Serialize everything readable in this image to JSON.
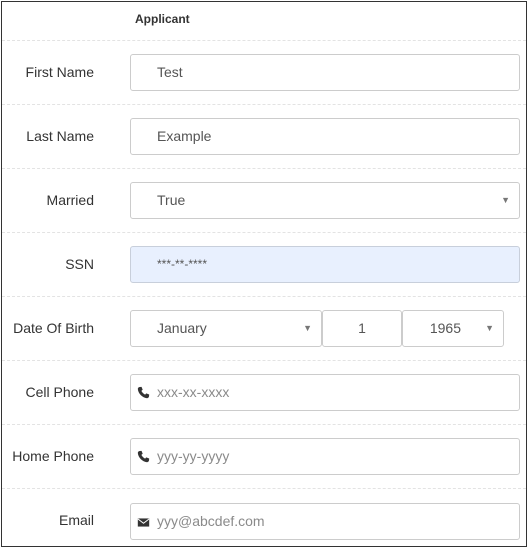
{
  "form": {
    "header": "Applicant",
    "first_name": {
      "label": "First Name",
      "value": "Test"
    },
    "last_name": {
      "label": "Last Name",
      "value": "Example"
    },
    "married": {
      "label": "Married",
      "value": "True"
    },
    "ssn": {
      "label": "SSN",
      "value": "***-**-****"
    },
    "dob": {
      "label": "Date Of Birth",
      "month": "January",
      "day": "1",
      "year": "1965"
    },
    "cell_phone": {
      "label": "Cell Phone",
      "placeholder": "xxx-xx-xxxx",
      "icon": "phone-icon"
    },
    "home_phone": {
      "label": "Home Phone",
      "placeholder": "yyy-yy-yyyy",
      "icon": "phone-icon"
    },
    "email": {
      "label": "Email",
      "placeholder": "yyy@abcdef.com",
      "icon": "envelope-icon"
    }
  },
  "colors": {
    "autofill_bg": "#e8f0fe",
    "border": "#cccccc"
  }
}
